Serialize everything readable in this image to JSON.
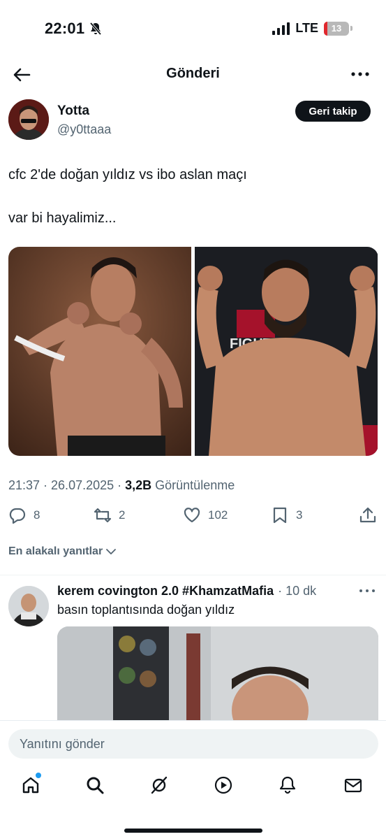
{
  "status_bar": {
    "time": "22:01",
    "network": "LTE",
    "battery": "13"
  },
  "header": {
    "title": "Gönderi"
  },
  "post": {
    "author_name": "Yotta",
    "author_handle": "@y0ttaaa",
    "follow_label": "Geri takip",
    "text_line1": "cfc 2'de doğan yıldız vs ibo aslan maçı",
    "text_line2": "var bi hayalimiz...",
    "timestamp": "21:37 · 26.07.2025 · ",
    "views_count": "3,2B",
    "views_label": " Görüntülenme",
    "replies": "8",
    "reposts": "2",
    "likes": "102",
    "bookmarks": "3"
  },
  "sort_label": "En alakalı yanıtlar",
  "reply": {
    "name": "kerem covington 2.0 #KhamzatMafia",
    "time": "· 10 dk",
    "text": "basın toplantısında doğan yıldız"
  },
  "compose": {
    "placeholder": "Yanıtını gönder"
  },
  "tabs": [
    "home-icon",
    "search-icon",
    "grok-icon",
    "video-icon",
    "notifications-icon",
    "messages-icon"
  ],
  "colors": {
    "accent": "#1d9bf0",
    "text": "#0f1419",
    "muted": "#536471",
    "battery_low": "#e0282e"
  }
}
